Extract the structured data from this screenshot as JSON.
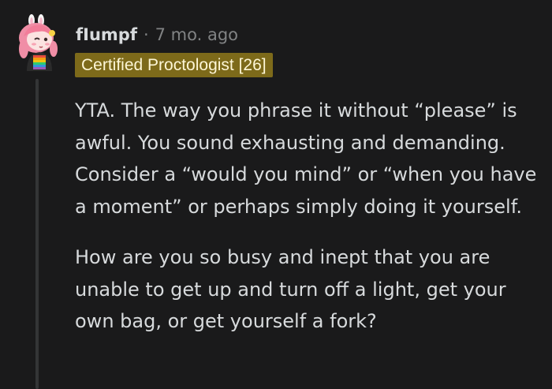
{
  "comment": {
    "username": "fIumpf",
    "separator": "·",
    "timestamp": "7 mo. ago",
    "flair": "Certified Proctologist [26]",
    "paragraphs": [
      "YTA. The way you phrase it without “please” is awful. You sound exhausting and demanding. Consider a “would you mind” or “when you have a moment” or perhaps simply doing it yourself.",
      "How are you so busy and inept that you are unable to get up and turn off a light, get your own bag, or get yourself a fork?"
    ]
  },
  "colors": {
    "background": "#1a1a1b",
    "text": "#d7dadc",
    "muted": "#818384",
    "flair_bg": "#7d6a1a",
    "flair_text": "#fdf6d6",
    "thread_line": "#343536"
  },
  "icons": {
    "avatar": "snoo-avatar-icon"
  }
}
